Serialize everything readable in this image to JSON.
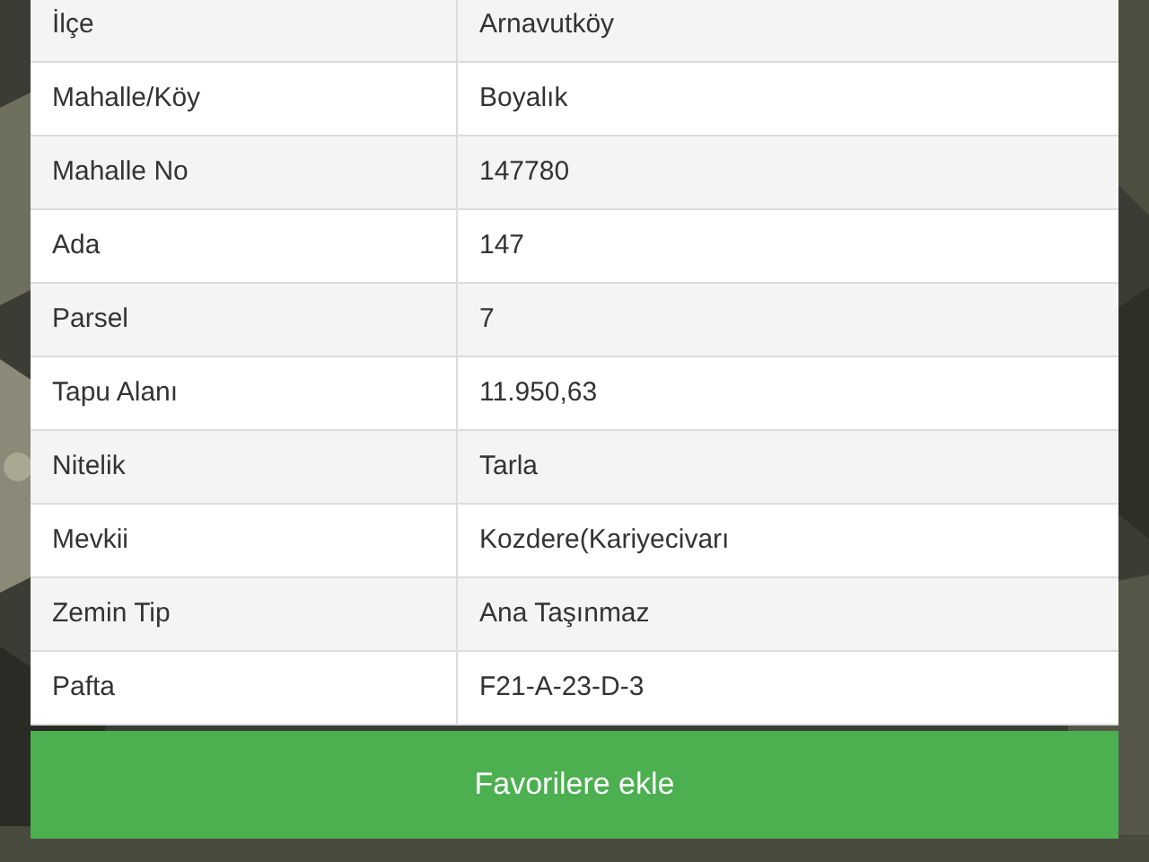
{
  "rows": [
    {
      "label": "İlçe",
      "value": "Arnavutköy"
    },
    {
      "label": "Mahalle/Köy",
      "value": "Boyalık"
    },
    {
      "label": "Mahalle No",
      "value": "147780"
    },
    {
      "label": "Ada",
      "value": "147"
    },
    {
      "label": "Parsel",
      "value": "7"
    },
    {
      "label": "Tapu Alanı",
      "value": "11.950,63"
    },
    {
      "label": "Nitelik",
      "value": "Tarla"
    },
    {
      "label": "Mevkii",
      "value": "Kozdere(Kariyecivarı"
    },
    {
      "label": "Zemin Tip",
      "value": "Ana Taşınmaz"
    },
    {
      "label": "Pafta",
      "value": "F21-A-23-D-3"
    }
  ],
  "button": {
    "label": "Favorilere ekle"
  }
}
